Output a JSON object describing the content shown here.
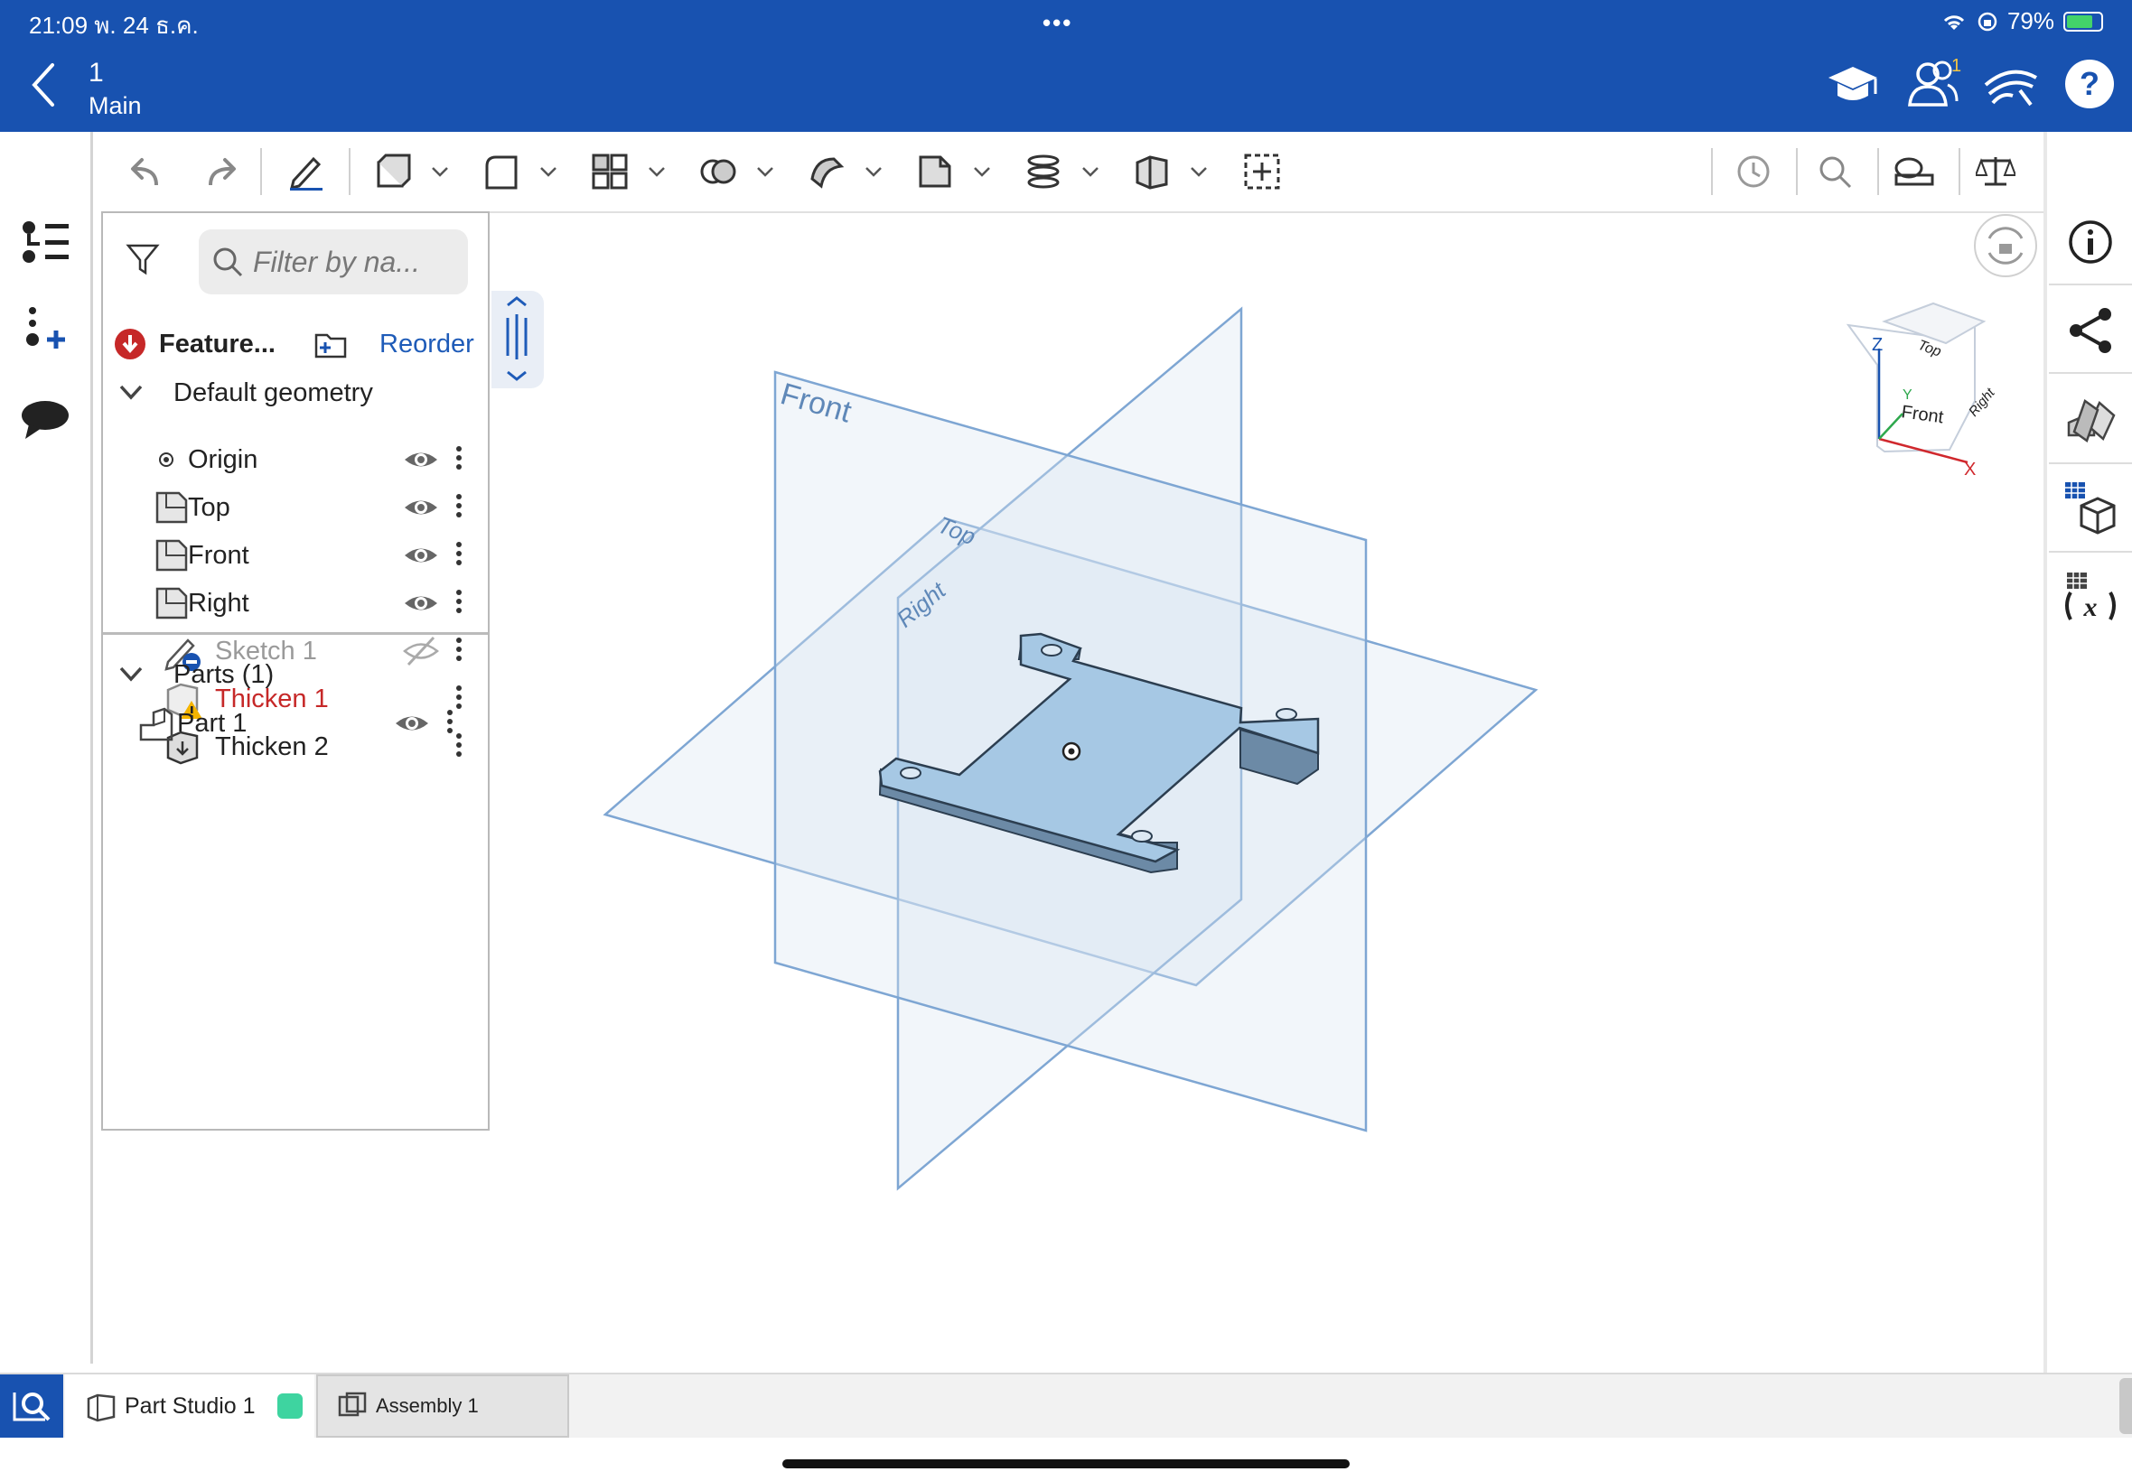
{
  "status_bar": {
    "time_date": "21:09   พ. 24 ธ.ค.",
    "dots": "•••",
    "battery_percent": "79%",
    "battery_level": 0.79
  },
  "header": {
    "document_number": "1",
    "branch": "Main",
    "notification_count": "1",
    "icons": [
      "learning-center-icon",
      "share-users-icon",
      "follow-mode-icon",
      "help-icon"
    ]
  },
  "left_rail": {
    "icons": [
      "feature-list-icon",
      "insert-node-icon",
      "comments-icon"
    ]
  },
  "toolbar": {
    "icons": [
      "undo-icon",
      "redo-icon",
      "sketch-icon",
      "extrude-icon",
      "fillet-icon",
      "pattern-icon",
      "boolean-icon",
      "sweep-icon",
      "plane-icon",
      "helix-icon",
      "part-icon",
      "insert-icon",
      "history-icon",
      "search-icon",
      "measure-icon",
      "mass-properties-icon"
    ]
  },
  "feature_panel": {
    "search_placeholder": "Filter by na...",
    "header_label": "Feature...",
    "reorder_label": "Reorder",
    "default_geometry_label": "Default geometry",
    "items": [
      {
        "label": "Origin",
        "icon": "origin-icon",
        "state": "normal"
      },
      {
        "label": "Top",
        "icon": "plane-icon",
        "state": "normal"
      },
      {
        "label": "Front",
        "icon": "plane-icon",
        "state": "normal"
      },
      {
        "label": "Right",
        "icon": "plane-icon",
        "state": "normal"
      },
      {
        "label": "Sketch 1",
        "icon": "sketch-icon",
        "state": "hidden"
      },
      {
        "label": "Thicken 1",
        "icon": "thicken-warning-icon",
        "state": "error"
      },
      {
        "label": "Thicken 2",
        "icon": "thicken-icon",
        "state": "normal"
      }
    ],
    "parts_label": "Parts (1)",
    "parts": [
      {
        "label": "Part 1",
        "icon": "part-icon"
      }
    ]
  },
  "viewport": {
    "plane_labels": {
      "front": "Front",
      "top": "Top",
      "right": "Right"
    },
    "view_cube": {
      "top": "Top",
      "front": "Front",
      "right": "Right",
      "axis_z": "Z",
      "axis_y": "Y",
      "axis_x": "X"
    }
  },
  "right_rail": {
    "icons": [
      "info-icon",
      "share-icon",
      "appearance-icon",
      "bom-icon",
      "variables-icon"
    ]
  },
  "bottom_tabs": [
    {
      "label": "Part Studio 1",
      "active": true
    },
    {
      "label": "Assembly 1",
      "active": false
    }
  ],
  "colors": {
    "brand_blue": "#1852b0",
    "error_red": "#c62828",
    "link_blue": "#1e5bb8",
    "plane_stroke": "#7ea6d3",
    "part_fill": "#a6c8e4"
  }
}
